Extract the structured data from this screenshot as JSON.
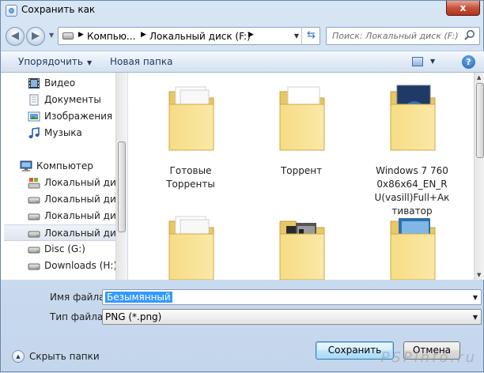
{
  "window": {
    "title": "Сохранить как",
    "close": "x"
  },
  "address": {
    "segments": [
      "Компью...",
      "Локальный диск (F:)"
    ],
    "search_placeholder": "Поиск: Локальный диск (F:)"
  },
  "toolbar": {
    "organize": "Упорядочить",
    "new_folder": "Новая папка",
    "help": "?"
  },
  "sidebar": {
    "items": [
      {
        "label": "Видео",
        "icon": "video-icon"
      },
      {
        "label": "Документы",
        "icon": "documents-icon"
      },
      {
        "label": "Изображения",
        "icon": "pictures-icon"
      },
      {
        "label": "Музыка",
        "icon": "music-icon"
      },
      {
        "label": "Компьютер",
        "icon": "computer-icon"
      },
      {
        "label": "Локальный диск",
        "icon": "system-drive-icon"
      },
      {
        "label": "Локальный диск",
        "icon": "drive-icon"
      },
      {
        "label": "Локальный диск",
        "icon": "drive-icon"
      },
      {
        "label": "Локальный диск",
        "icon": "drive-icon",
        "selected": true
      },
      {
        "label": "Disc  (G:)",
        "icon": "drive-icon"
      },
      {
        "label": "Downloads (H:)",
        "icon": "drive-icon"
      }
    ]
  },
  "folders": [
    {
      "name": "Готовые Торренты",
      "icon": "folder-documents-icon"
    },
    {
      "name": "Торрент",
      "icon": "folder-torrent-icon"
    },
    {
      "name": "Windows 7 7600x86x64_EN_RU(vasill)Full+Активатор",
      "icon": "folder-windows-icon"
    },
    {
      "name": "",
      "icon": "folder-documents-icon"
    },
    {
      "name": "",
      "icon": "folder-images-icon"
    },
    {
      "name": "",
      "icon": "folder-blue-image-icon"
    }
  ],
  "fields": {
    "filename_label": "Имя файла:",
    "filename_value": "Безымянный",
    "filetype_label": "Тип файла:",
    "filetype_value": "PNG (*.png)"
  },
  "footer": {
    "hide_folders": "Скрыть папки",
    "save": "Сохранить",
    "cancel": "Отмена",
    "watermark": "PSPinfo.ru"
  }
}
